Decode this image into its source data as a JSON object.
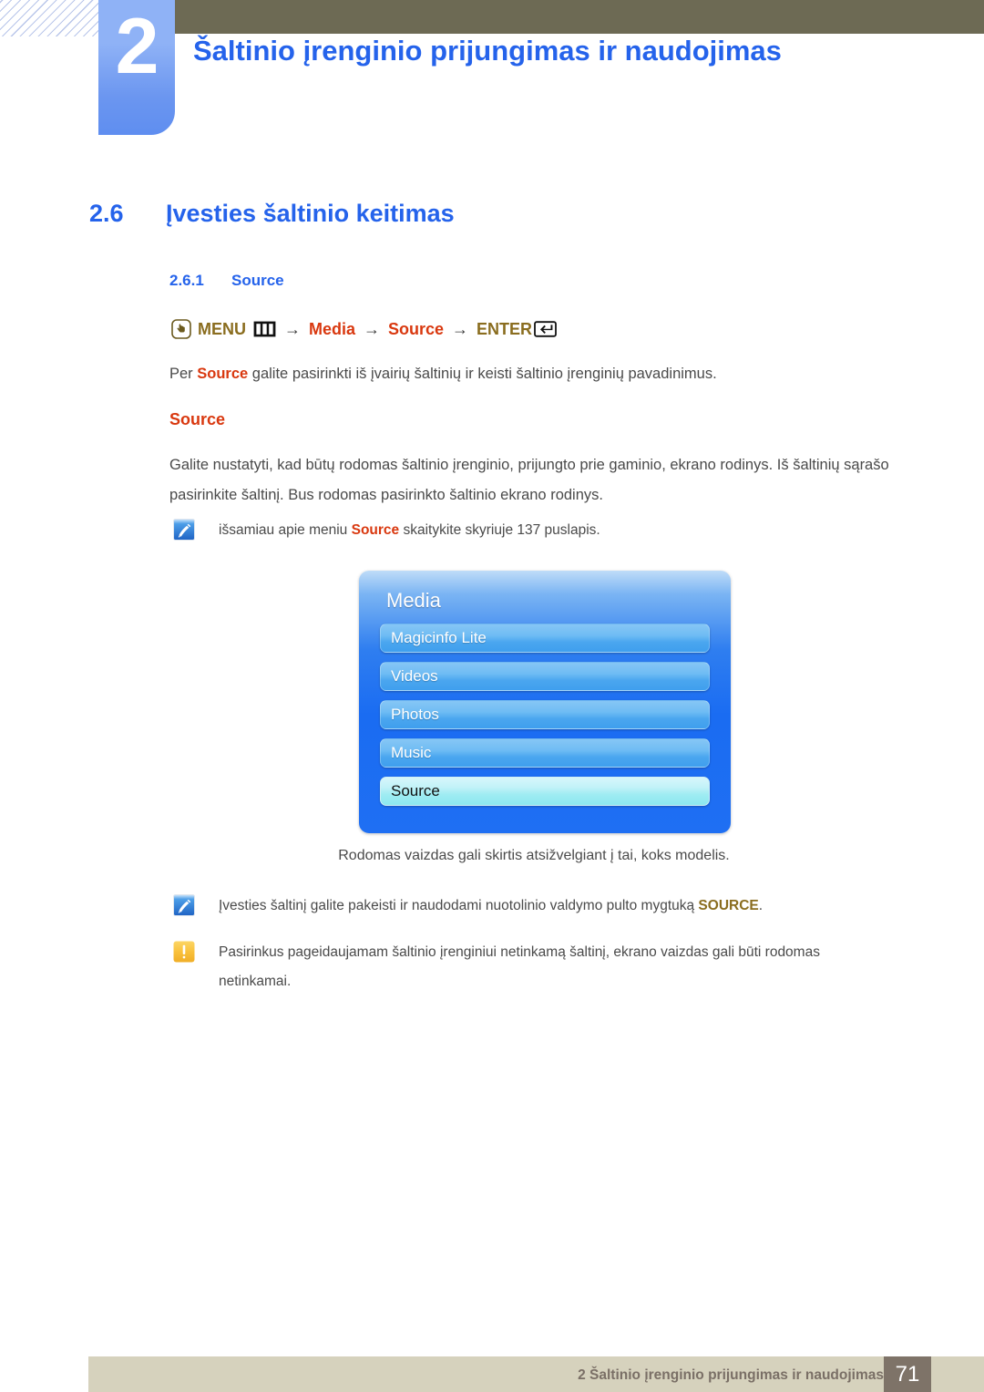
{
  "header": {
    "chapter_number": "2",
    "chapter_title": "Šaltinio įrenginio prijungimas ir naudojimas",
    "olive_bar_color": "#6d6a54",
    "tab_color": "#6b96f0",
    "title_color": "#2563eb"
  },
  "section": {
    "h2_number": "2.6",
    "h2_title": "Įvesties šaltinio keitimas",
    "h3_number": "2.6.1",
    "h3_title": "Source"
  },
  "menu_path": {
    "hand_icon": "hand-press-icon",
    "menu_label": "MENU",
    "bars_icon": "menu-bars-icon",
    "arrow": "→",
    "media_label": "Media",
    "source_label": "Source",
    "enter_label": "ENTER",
    "enter_icon": "enter-key-icon",
    "gold_color": "#8a6d1f",
    "red_color": "#d9380f"
  },
  "body": {
    "intro_prefix": "Per ",
    "intro_bold": "Source",
    "intro_suffix": " galite pasirinkti iš įvairių šaltinių ir keisti šaltinio įrenginių pavadinimus.",
    "sub_heading": "Source",
    "main_paragraph": "Galite nustatyti, kad būtų rodomas šaltinio įrenginio, prijungto prie gaminio, ekrano rodinys. Iš šaltinių sąrašo pasirinkite šaltinį. Bus rodomas pasirinkto šaltinio ekrano rodinys."
  },
  "notes": [
    {
      "icon": "note-pencil-icon",
      "prefix": "išsamiau apie meniu ",
      "bold": "Source",
      "bold_style": "red",
      "suffix": " skaitykite skyriuje 137 puslapis."
    },
    {
      "icon": "note-pencil-icon",
      "prefix": "Įvesties šaltinį galite pakeisti ir naudodami nuotolinio valdymo pulto mygtuką ",
      "bold": "SOURCE",
      "bold_style": "gold",
      "suffix": "."
    },
    {
      "icon": "warning-exclamation-icon",
      "prefix": "Pasirinkus pageidaujamam šaltinio įrenginiui netinkamą šaltinį, ekrano vaizdas gali būti rodomas netinkamai.",
      "bold": "",
      "bold_style": "none",
      "suffix": ""
    }
  ],
  "osd": {
    "title": "Media",
    "items": [
      {
        "label": "Magicinfo Lite",
        "selected": false
      },
      {
        "label": "Videos",
        "selected": false
      },
      {
        "label": "Photos",
        "selected": false
      },
      {
        "label": "Music",
        "selected": false
      },
      {
        "label": "Source",
        "selected": true
      }
    ],
    "caption": "Rodomas vaizdas gali skirtis atsižvelgiant į tai, koks modelis.",
    "panel_color": "#1a6cf2",
    "item_color": "#4aa6ef",
    "selected_color": "#9fecf2"
  },
  "footer": {
    "text": "2 Šaltinio įrenginio prijungimas ir naudojimas",
    "page_number": "71",
    "bar_color": "#d6d2bd",
    "page_box_color": "#7e7368"
  }
}
